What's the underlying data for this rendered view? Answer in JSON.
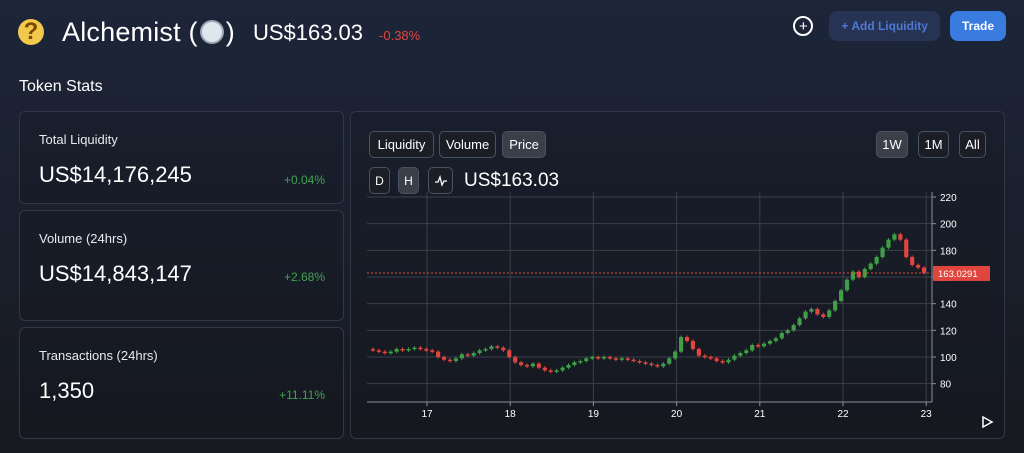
{
  "header": {
    "emoji": "🤔",
    "name": "Alchemist (",
    "name_close": ")",
    "price": "US$163.03",
    "change": "-0.38%",
    "add_liquidity": "+ Add Liquidity",
    "trade": "Trade",
    "plus_icon": "+"
  },
  "section": {
    "title": "Token Stats"
  },
  "stats": [
    {
      "label": "Total Liquidity",
      "value": "US$14,176,245",
      "change": "+0.04%"
    },
    {
      "label": "Volume (24hrs)",
      "value": "US$14,843,147",
      "change": "+2.68%"
    },
    {
      "label": "Transactions (24hrs)",
      "value": "1,350",
      "change": "+11.11%"
    }
  ],
  "chart": {
    "tabs": [
      "Liquidity",
      "Volume",
      "Price"
    ],
    "active_tab": "Price",
    "ranges": [
      "1W",
      "1M",
      "All"
    ],
    "active_range": "1W",
    "interval": [
      "D",
      "H"
    ],
    "active_interval": "H",
    "price": "US$163.03",
    "current_label": "163.0291",
    "colors": {
      "up": "#3e9f45",
      "down": "#e0463d",
      "current": "#e0463d"
    }
  },
  "chart_data": {
    "type": "candlestick",
    "x_ticks": [
      "17",
      "18",
      "19",
      "20",
      "21",
      "22",
      "23"
    ],
    "y_ticks": [
      80,
      100,
      120,
      140,
      160,
      180,
      200,
      220
    ],
    "ylim": [
      70,
      220
    ],
    "current_price": 163.0291,
    "grid": true,
    "closes": [
      105,
      104,
      103,
      104,
      106,
      105,
      106,
      107,
      106,
      105,
      104,
      100,
      98,
      97,
      99,
      102,
      101,
      103,
      105,
      106,
      108,
      107,
      105,
      100,
      96,
      94,
      93,
      95,
      92,
      90,
      89,
      90,
      92,
      94,
      96,
      97,
      99,
      100,
      99,
      100,
      99,
      98,
      99,
      98,
      97,
      96,
      95,
      94,
      93,
      95,
      99,
      104,
      115,
      112,
      106,
      101,
      100,
      99,
      97,
      96,
      98,
      101,
      103,
      105,
      109,
      108,
      110,
      112,
      114,
      118,
      120,
      124,
      129,
      134,
      136,
      132,
      130,
      135,
      142,
      150,
      158,
      164,
      160,
      166,
      170,
      175,
      182,
      188,
      192,
      188,
      175,
      169,
      167,
      163
    ]
  }
}
